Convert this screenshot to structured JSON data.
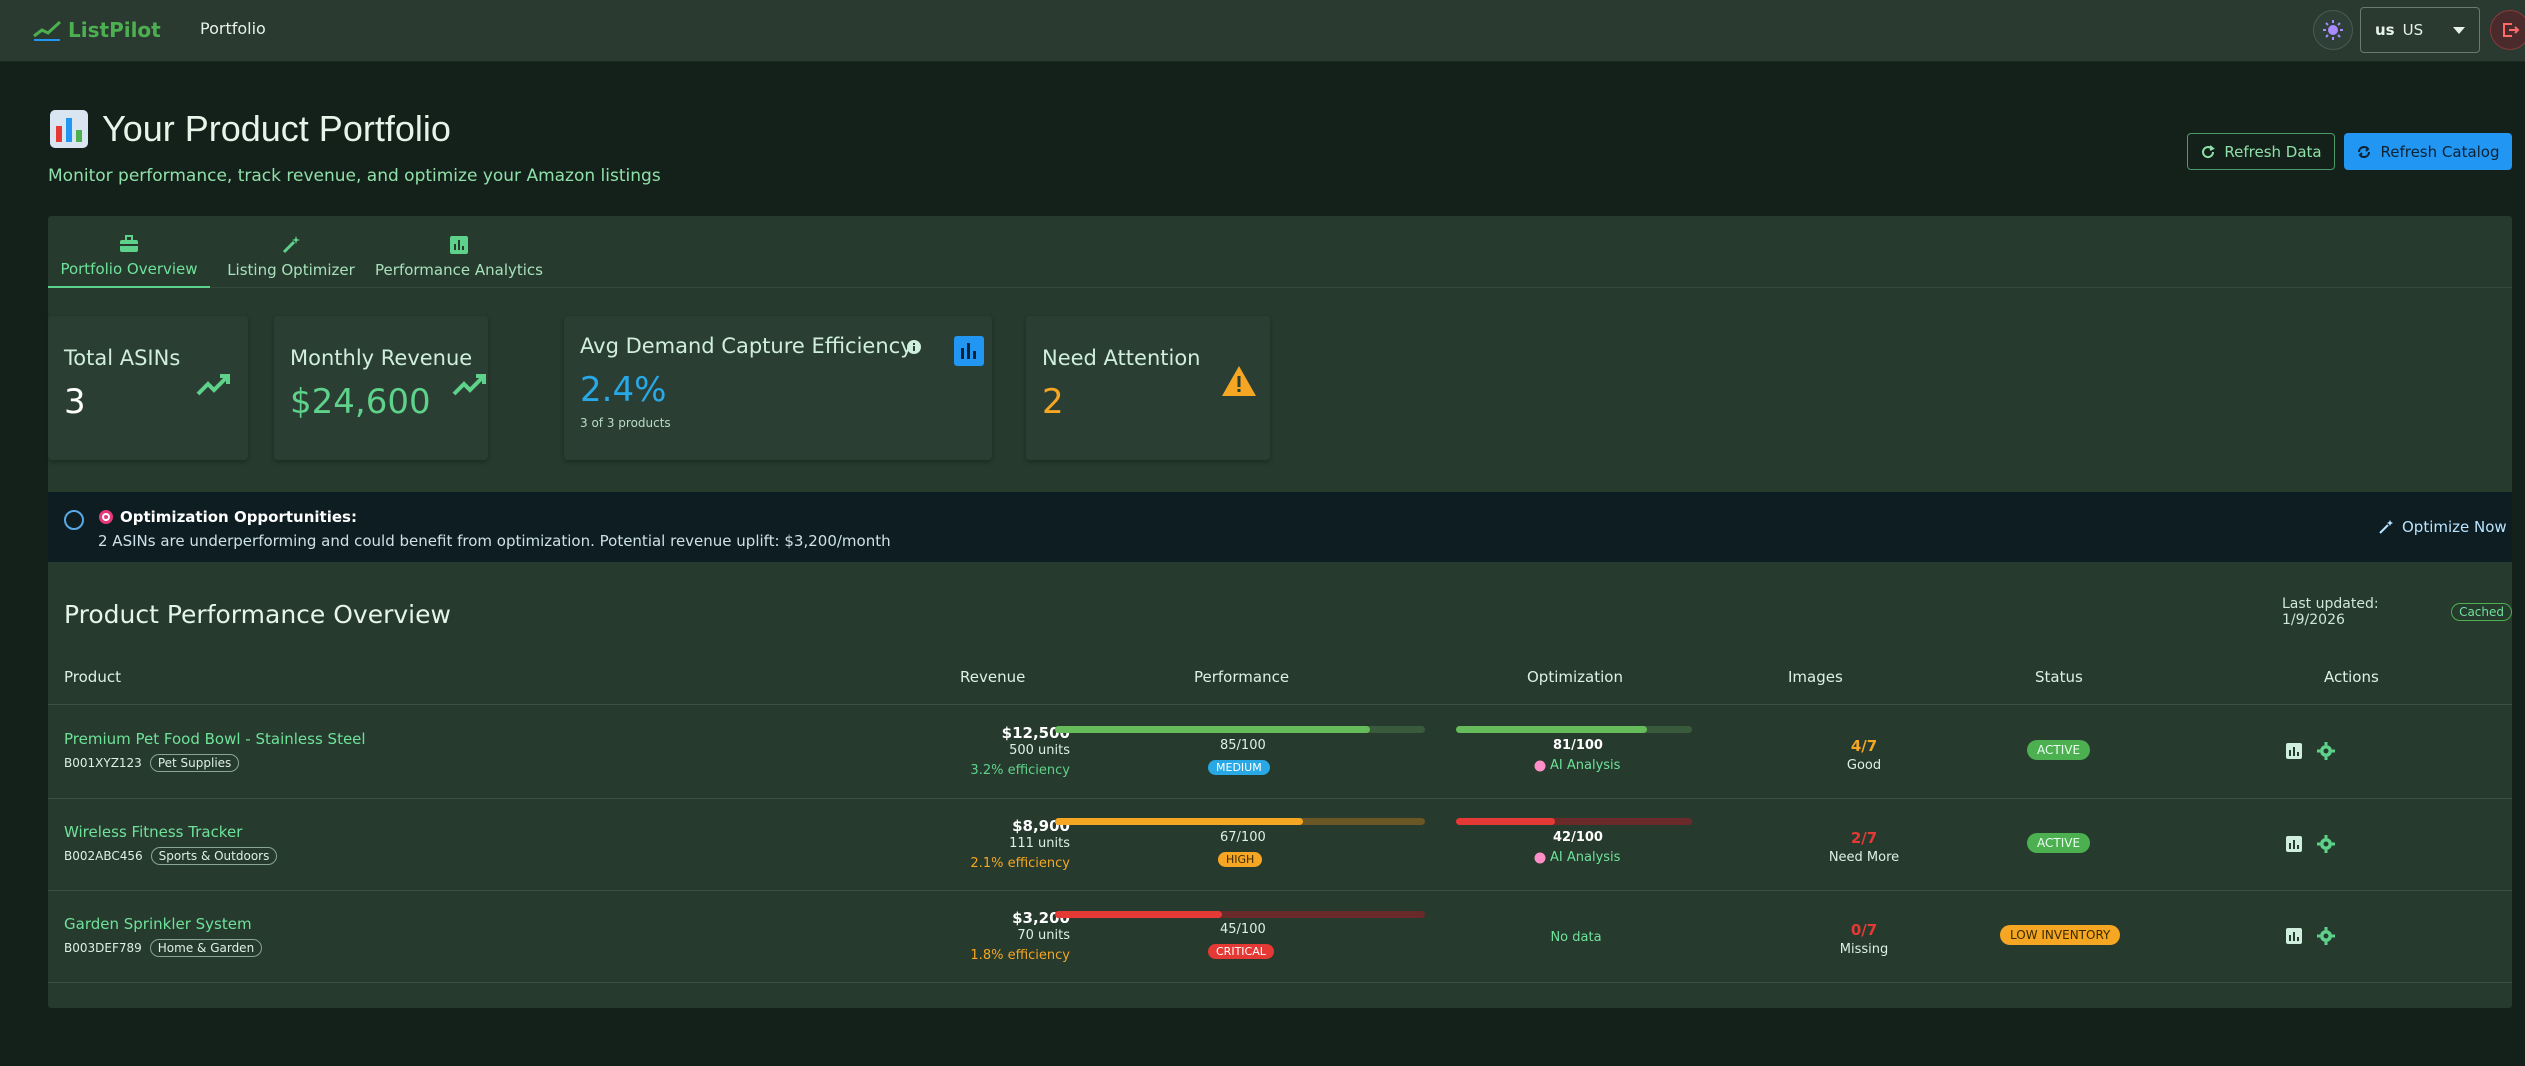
{
  "app": {
    "name": "ListPilot",
    "nav_link": "Portfolio"
  },
  "region": {
    "flag": "us",
    "value": "US"
  },
  "header": {
    "title": "Your Product Portfolio",
    "subtitle": "Monitor performance, track revenue, and optimize your Amazon listings",
    "refresh_data_label": "Refresh Data",
    "refresh_catalog_label": "Refresh Catalog"
  },
  "tabs": [
    {
      "label": "Portfolio Overview",
      "icon": "briefcase-icon"
    },
    {
      "label": "Listing Optimizer",
      "icon": "magic-wand-icon"
    },
    {
      "label": "Performance Analytics",
      "icon": "bar-chart-icon"
    }
  ],
  "stats": {
    "total_asins": {
      "label": "Total ASINs",
      "value": "3"
    },
    "monthly_revenue": {
      "label": "Monthly Revenue",
      "value": "$24,600"
    },
    "efficiency": {
      "label": "Avg Demand Capture Efficiency",
      "value": "2.4%",
      "sub": "3 of 3 products"
    },
    "attention": {
      "label": "Need Attention",
      "value": "2"
    }
  },
  "alert": {
    "title": "Optimization Opportunities:",
    "text": "2 ASINs are underperforming and could benefit from optimization. Potential revenue uplift: $3,200/month",
    "action": "Optimize Now"
  },
  "overview": {
    "title": "Product Performance Overview",
    "last_updated": "Last updated: 1/9/2026",
    "cached": "Cached"
  },
  "table": {
    "headers": {
      "product": "Product",
      "revenue": "Revenue",
      "performance": "Performance",
      "optimization": "Optimization",
      "images": "Images",
      "status": "Status",
      "actions": "Actions"
    },
    "rows": [
      {
        "name": "Premium Pet Food Bowl - Stainless Steel",
        "asin": "B001XYZ123",
        "category": "Pet Supplies",
        "revenue": "$12,500",
        "units": "500 units",
        "efficiency": "3.2% efficiency",
        "performance_score": "85/100",
        "performance_value": 85,
        "performance_level": "MEDIUM",
        "optimization_score": "81/100",
        "optimization_value": 81,
        "optimization_link": "AI Analysis",
        "images": "4/7",
        "images_label": "Good",
        "status": "ACTIVE"
      },
      {
        "name": "Wireless Fitness Tracker",
        "asin": "B002ABC456",
        "category": "Sports & Outdoors",
        "revenue": "$8,900",
        "units": "111 units",
        "efficiency": "2.1% efficiency",
        "performance_score": "67/100",
        "performance_value": 67,
        "performance_level": "HIGH",
        "optimization_score": "42/100",
        "optimization_value": 42,
        "optimization_link": "AI Analysis",
        "images": "2/7",
        "images_label": "Need More",
        "status": "ACTIVE"
      },
      {
        "name": "Garden Sprinkler System",
        "asin": "B003DEF789",
        "category": "Home & Garden",
        "revenue": "$3,200",
        "units": "70 units",
        "efficiency": "1.8% efficiency",
        "performance_score": "45/100",
        "performance_value": 45,
        "performance_level": "CRITICAL",
        "optimization_text": "No data",
        "images": "0/7",
        "images_label": "Missing",
        "status": "LOW INVENTORY"
      }
    ]
  },
  "colors": {
    "accent_green": "#5ed28a",
    "primary_blue": "#2196f3",
    "warning_orange": "#f5a623",
    "critical_red": "#e53935"
  }
}
